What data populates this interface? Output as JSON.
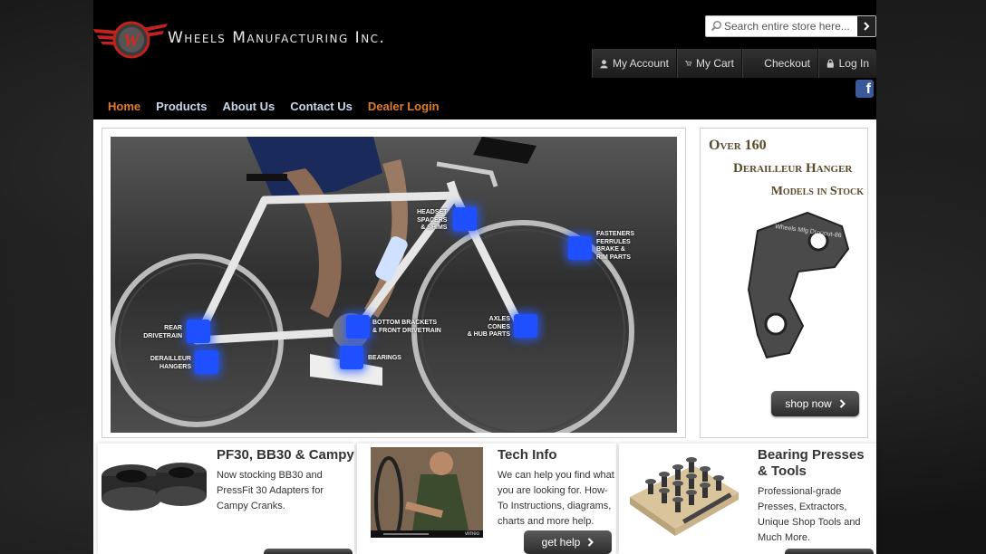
{
  "brand": {
    "name": "Wheels Manufacturing Inc.",
    "accent": "#e07b2a",
    "nav_color": "#c8d8ec"
  },
  "search": {
    "placeholder": "Search entire store here..."
  },
  "account_bar": {
    "my_account": "My Account",
    "my_cart": "My Cart",
    "checkout": "Checkout",
    "login": "Log In"
  },
  "social": {
    "facebook_letter": "f"
  },
  "nav": [
    {
      "label": "Home",
      "highlight": true
    },
    {
      "label": "Products",
      "highlight": false
    },
    {
      "label": "About Us",
      "highlight": false
    },
    {
      "label": "Contact Us",
      "highlight": false
    },
    {
      "label": "Dealer Login",
      "highlight": true
    }
  ],
  "hero": {
    "hotspots": [
      {
        "label": [
          "HEADSET",
          "SPACERS",
          "& SHIMS"
        ]
      },
      {
        "label": [
          "FASTENERS",
          "FERRULES",
          "BRAKE &",
          "RIM PARTS"
        ]
      },
      {
        "label": [
          "REAR",
          "DRIVETRAIN"
        ]
      },
      {
        "label": [
          "BOTTOM BRACKETS",
          "& FRONT DRIVETRAIN"
        ]
      },
      {
        "label": [
          "AXLES",
          "CONES",
          "& HUB PARTS"
        ]
      },
      {
        "label": [
          "DERAILLEUR",
          "HANGERS"
        ]
      },
      {
        "label": [
          "BEARINGS"
        ]
      }
    ],
    "frame_text": "Wheels Mfg Dropout-86"
  },
  "promo": {
    "line1": "Over 160",
    "line2": "Derailleur Hanger",
    "line3": "Models in Stock",
    "hanger_text": "Wheels Mfg Dropout-86",
    "button": "shop now"
  },
  "cards": [
    {
      "title": "PF30, BB30 & Campy",
      "text": [
        "Now stocking BB30 and",
        "PressFit 30 Adapters for",
        "Campy Cranks."
      ],
      "button": ""
    },
    {
      "title": "Tech Info",
      "text": [
        "We can help you find what",
        "you are looking for. How-",
        "To Instructions, diagrams,",
        "charts and more help."
      ],
      "button": "get help",
      "video_brand": "vimeo"
    },
    {
      "title": [
        "Bearing Presses",
        "& Tools"
      ],
      "text": [
        "Professional-grade",
        "Presses, Extractors,",
        "Unique Shop Tools and",
        "Much More."
      ],
      "button": ""
    }
  ]
}
